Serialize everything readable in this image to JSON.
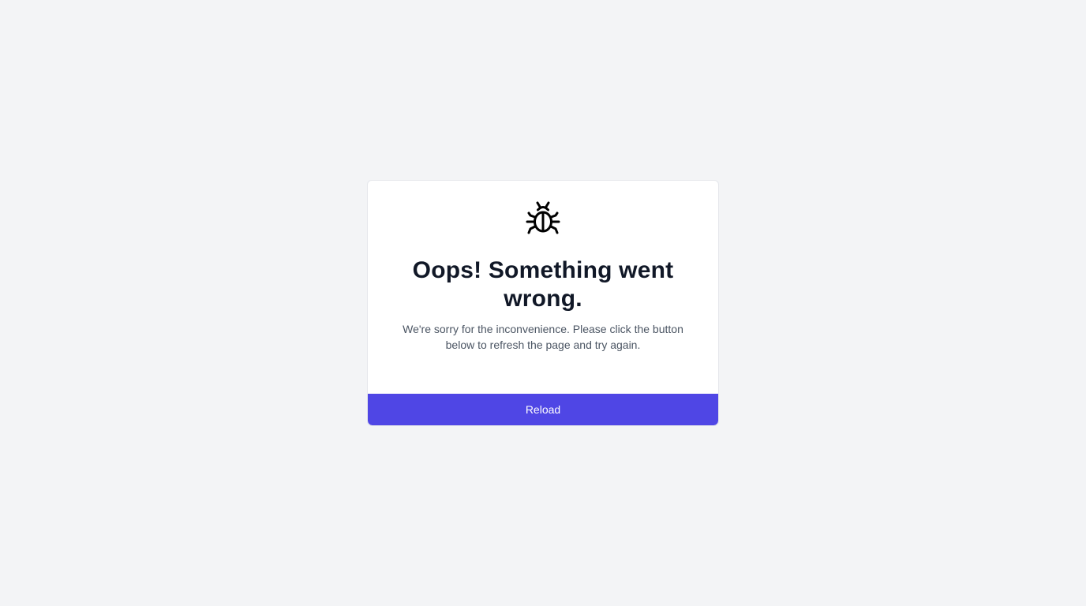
{
  "error": {
    "icon": "bug-icon",
    "title": "Oops! Something went wrong.",
    "message": "We're sorry for the inconvenience. Please click the button below to refresh the page and try again.",
    "reload_label": "Reload"
  },
  "colors": {
    "page_background": "#f3f4f6",
    "card_background": "#ffffff",
    "title_text": "#111827",
    "message_text": "#4b5563",
    "button_background": "#4f46e5",
    "button_text": "#ffffff"
  }
}
